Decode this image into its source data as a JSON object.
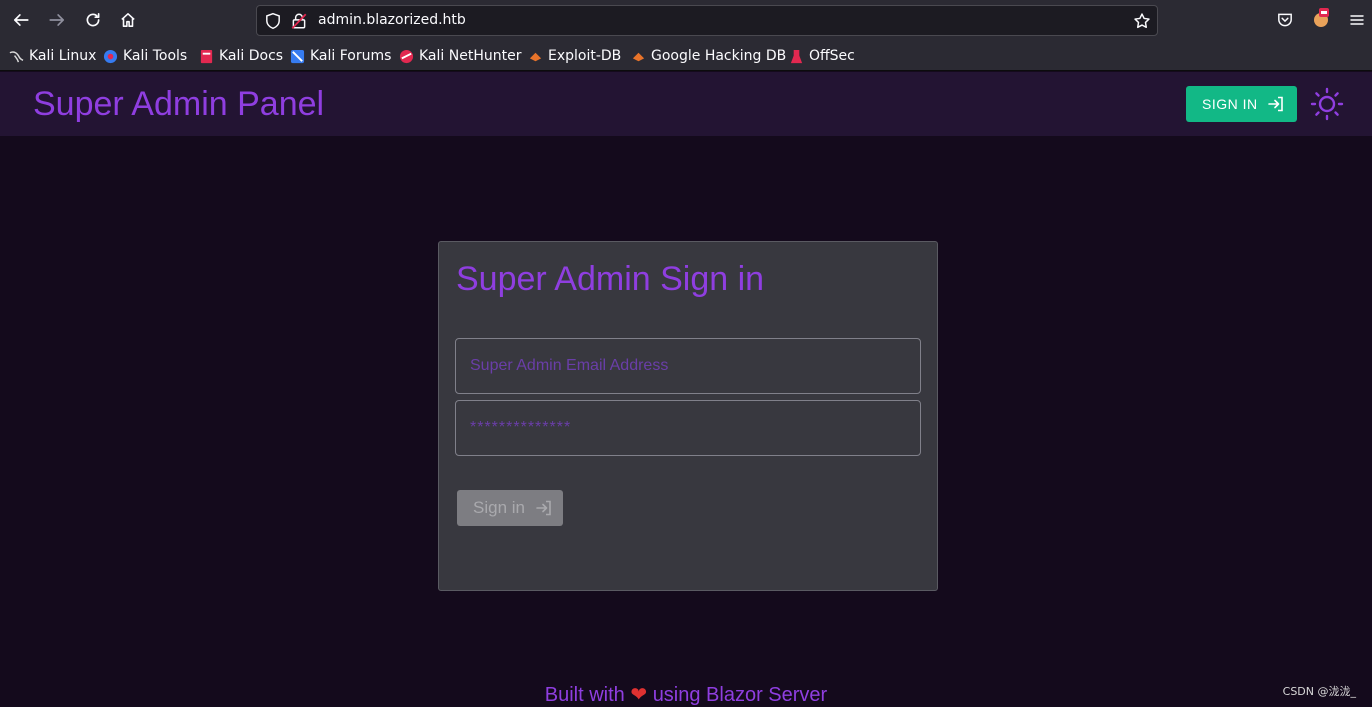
{
  "browser": {
    "url": "admin.blazorized.htb",
    "bookmarks": [
      {
        "label": "Kali Linux",
        "icon": "kali-dragon-icon"
      },
      {
        "label": "Kali Tools",
        "icon": "kali-tools-icon"
      },
      {
        "label": "Kali Docs",
        "icon": "kali-docs-icon"
      },
      {
        "label": "Kali Forums",
        "icon": "kali-forums-icon"
      },
      {
        "label": "Kali NetHunter",
        "icon": "nethunter-icon"
      },
      {
        "label": "Exploit-DB",
        "icon": "exploit-db-icon"
      },
      {
        "label": "Google Hacking DB",
        "icon": "ghdb-icon"
      },
      {
        "label": "OffSec",
        "icon": "offsec-icon"
      }
    ]
  },
  "header": {
    "title": "Super Admin Panel",
    "signin_label": "SIGN IN"
  },
  "card": {
    "title": "Super Admin Sign in",
    "email_placeholder": "Super Admin Email Address",
    "password_placeholder": "**************",
    "signin_label": "Sign in"
  },
  "footer": {
    "before": "Built with",
    "heart": "❤",
    "after": "using Blazor Server"
  },
  "watermark": "CSDN @泷泷_",
  "colors": {
    "accent": "#8f3ee0",
    "success": "#12b886",
    "background": "#140a1c",
    "header_bg": "#231433",
    "card_bg": "#38383f"
  }
}
